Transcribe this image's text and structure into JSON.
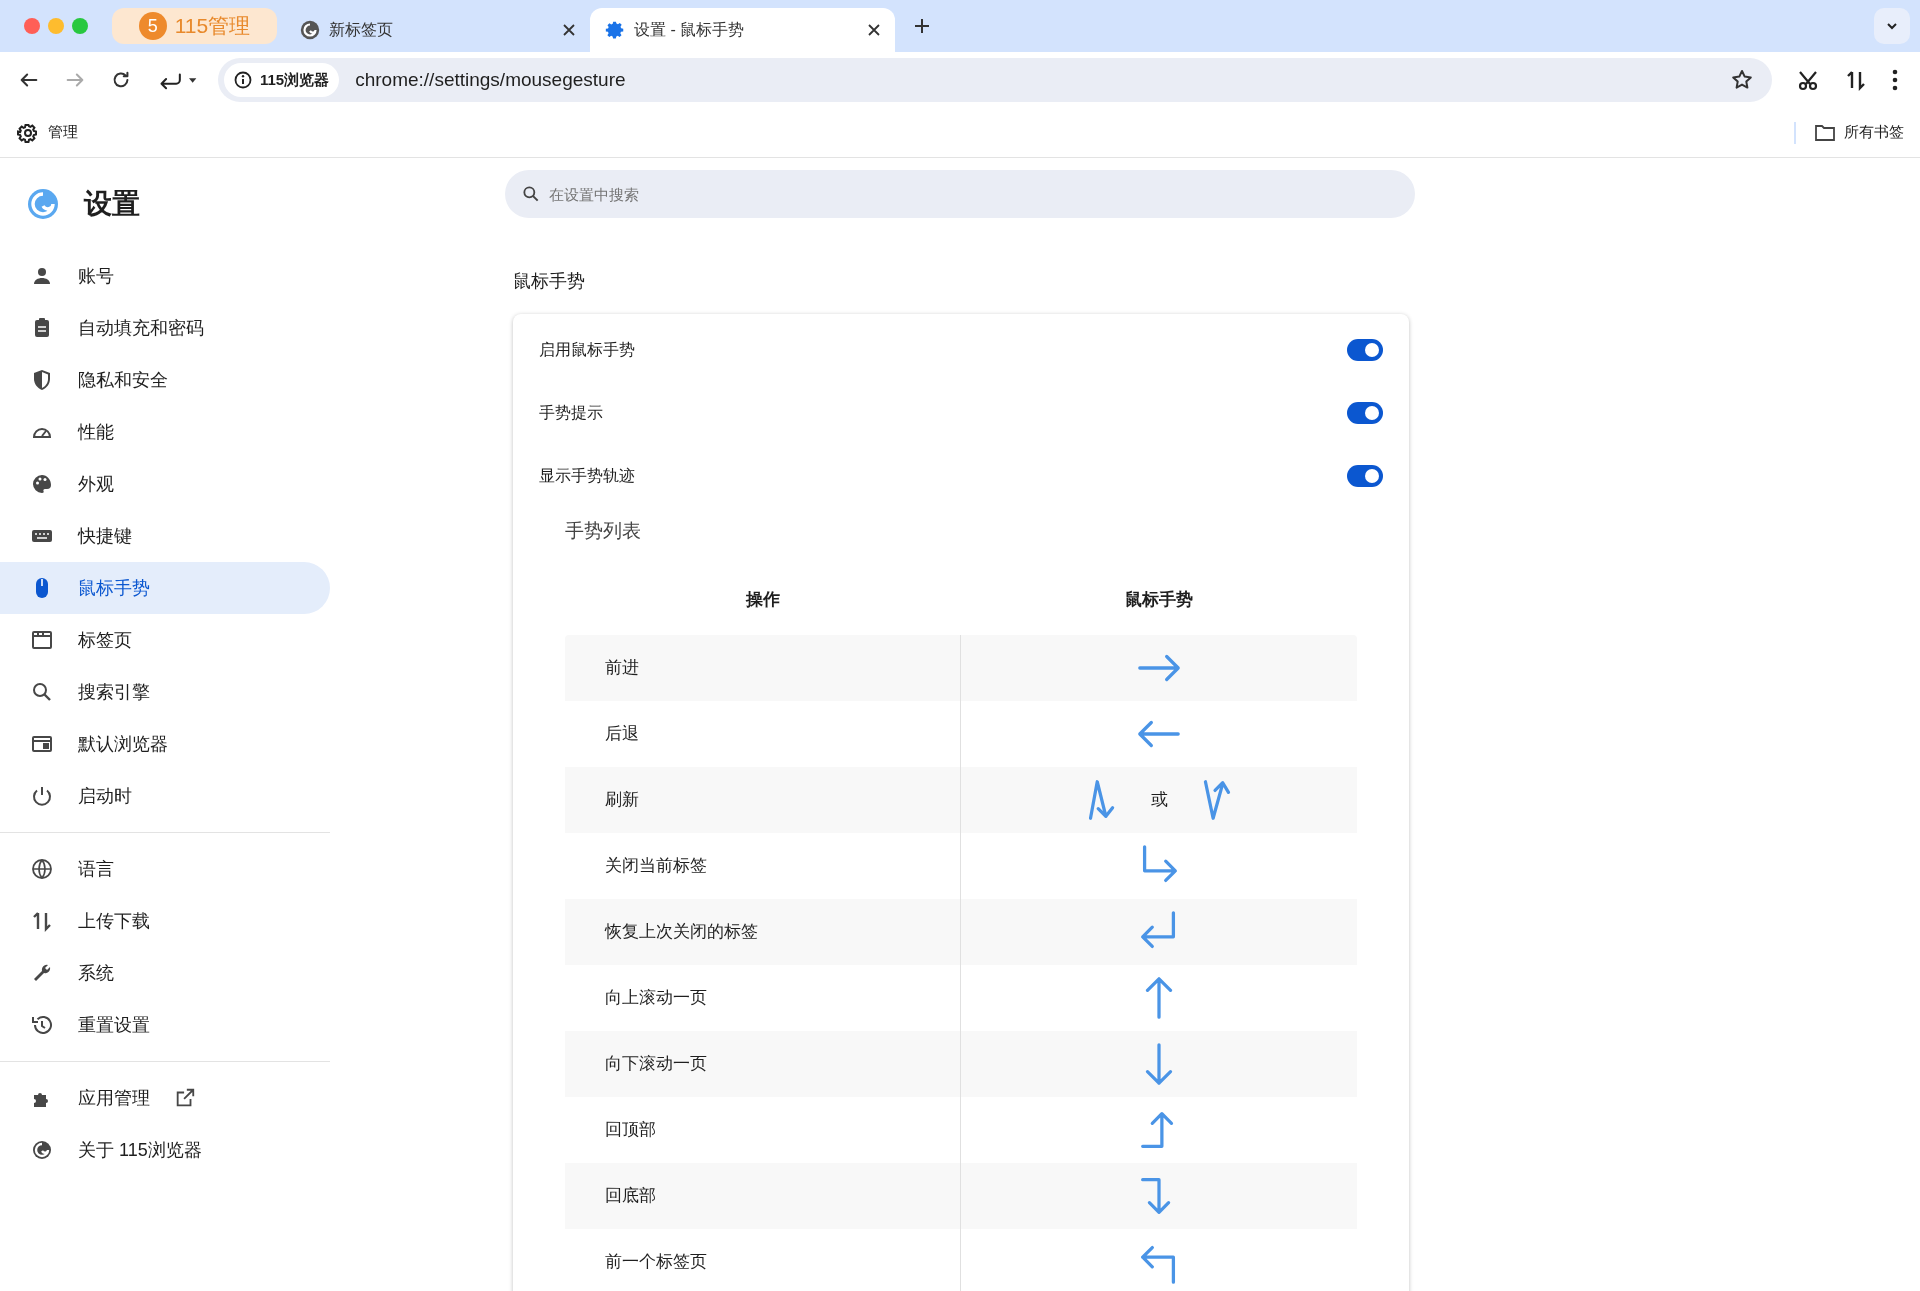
{
  "tabs": [
    {
      "badge": "5",
      "label": "115管理",
      "selected": false,
      "kind": "pinned"
    },
    {
      "label": "新标签页",
      "selected": false,
      "kind": "normal"
    },
    {
      "label": "设置 - 鼠标手势",
      "selected": true,
      "kind": "normal"
    }
  ],
  "toolbar": {
    "back_disabled": false,
    "forward_disabled": true,
    "site_chip": "115浏览器",
    "url": "chrome://settings/mousegesture"
  },
  "bookmarks": {
    "manage": "管理",
    "all": "所有书签"
  },
  "sidebar": {
    "title": "设置",
    "groups": [
      [
        {
          "label": "账号",
          "selected": false
        },
        {
          "label": "自动填充和密码",
          "selected": false
        },
        {
          "label": "隐私和安全",
          "selected": false
        },
        {
          "label": "性能",
          "selected": false
        },
        {
          "label": "外观",
          "selected": false
        },
        {
          "label": "快捷键",
          "selected": false
        },
        {
          "label": "鼠标手势",
          "selected": true
        },
        {
          "label": "标签页",
          "selected": false
        },
        {
          "label": "搜索引擎",
          "selected": false
        },
        {
          "label": "默认浏览器",
          "selected": false
        },
        {
          "label": "启动时",
          "selected": false
        }
      ],
      [
        {
          "label": "语言",
          "selected": false
        },
        {
          "label": "上传下载",
          "selected": false
        },
        {
          "label": "系统",
          "selected": false
        },
        {
          "label": "重置设置",
          "selected": false
        }
      ],
      [
        {
          "label": "应用管理",
          "selected": false,
          "external": true
        },
        {
          "label": "关于 115浏览器",
          "selected": false
        }
      ]
    ]
  },
  "search": {
    "placeholder": "在设置中搜索"
  },
  "section_title": "鼠标手势",
  "toggles": [
    {
      "label": "启用鼠标手势",
      "on": true
    },
    {
      "label": "手势提示",
      "on": true
    },
    {
      "label": "显示手势轨迹",
      "on": true
    }
  ],
  "gesture_list": {
    "title": "手势列表",
    "columns": [
      "操作",
      "鼠标手势"
    ],
    "rows": [
      {
        "action": "前进",
        "gestures": [
          {
            "kind": "right"
          }
        ]
      },
      {
        "action": "后退",
        "gestures": [
          {
            "kind": "left"
          }
        ]
      },
      {
        "action": "刷新",
        "gestures": [
          {
            "kind": "updown"
          },
          {
            "kind": "downup"
          }
        ],
        "separator": "或"
      },
      {
        "action": "关闭当前标签",
        "gestures": [
          {
            "kind": "downright"
          }
        ]
      },
      {
        "action": "恢复上次关闭的标签",
        "gestures": [
          {
            "kind": "downleft"
          }
        ]
      },
      {
        "action": "向上滚动一页",
        "gestures": [
          {
            "kind": "up"
          }
        ]
      },
      {
        "action": "向下滚动一页",
        "gestures": [
          {
            "kind": "down"
          }
        ]
      },
      {
        "action": "回顶部",
        "gestures": [
          {
            "kind": "rightup"
          }
        ]
      },
      {
        "action": "回底部",
        "gestures": [
          {
            "kind": "rightdown"
          }
        ]
      },
      {
        "action": "前一个标签页",
        "gestures": [
          {
            "kind": "upleft"
          }
        ]
      }
    ]
  }
}
